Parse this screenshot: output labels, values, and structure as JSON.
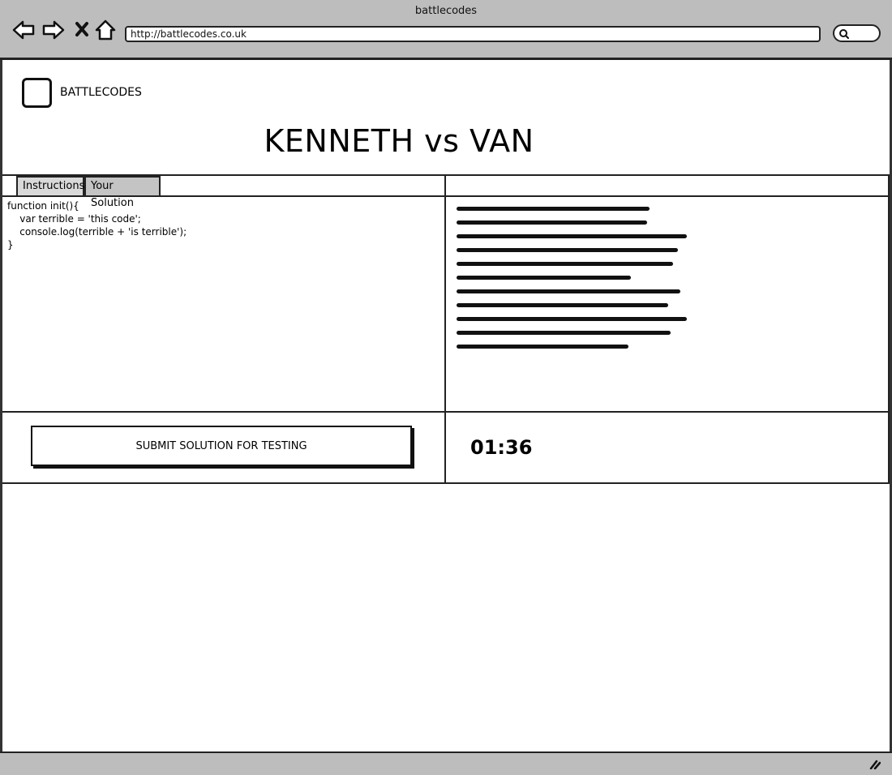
{
  "window": {
    "title": "battlecodes"
  },
  "browser": {
    "url": "http://battlecodes.co.uk"
  },
  "header": {
    "logo_text": "BATTLECODES",
    "match_title": "KENNETH vs VAN"
  },
  "tabs": [
    {
      "label": "Instructions"
    },
    {
      "label": "Your Solution"
    }
  ],
  "editor": {
    "code_lines": [
      "function init(){",
      "    var terrible = 'this code';",
      "    console.log(terrible + 'is terrible');",
      "}"
    ]
  },
  "actions": {
    "submit_label": "SUBMIT SOLUTION FOR TESTING"
  },
  "timer": {
    "value": "01:36"
  }
}
